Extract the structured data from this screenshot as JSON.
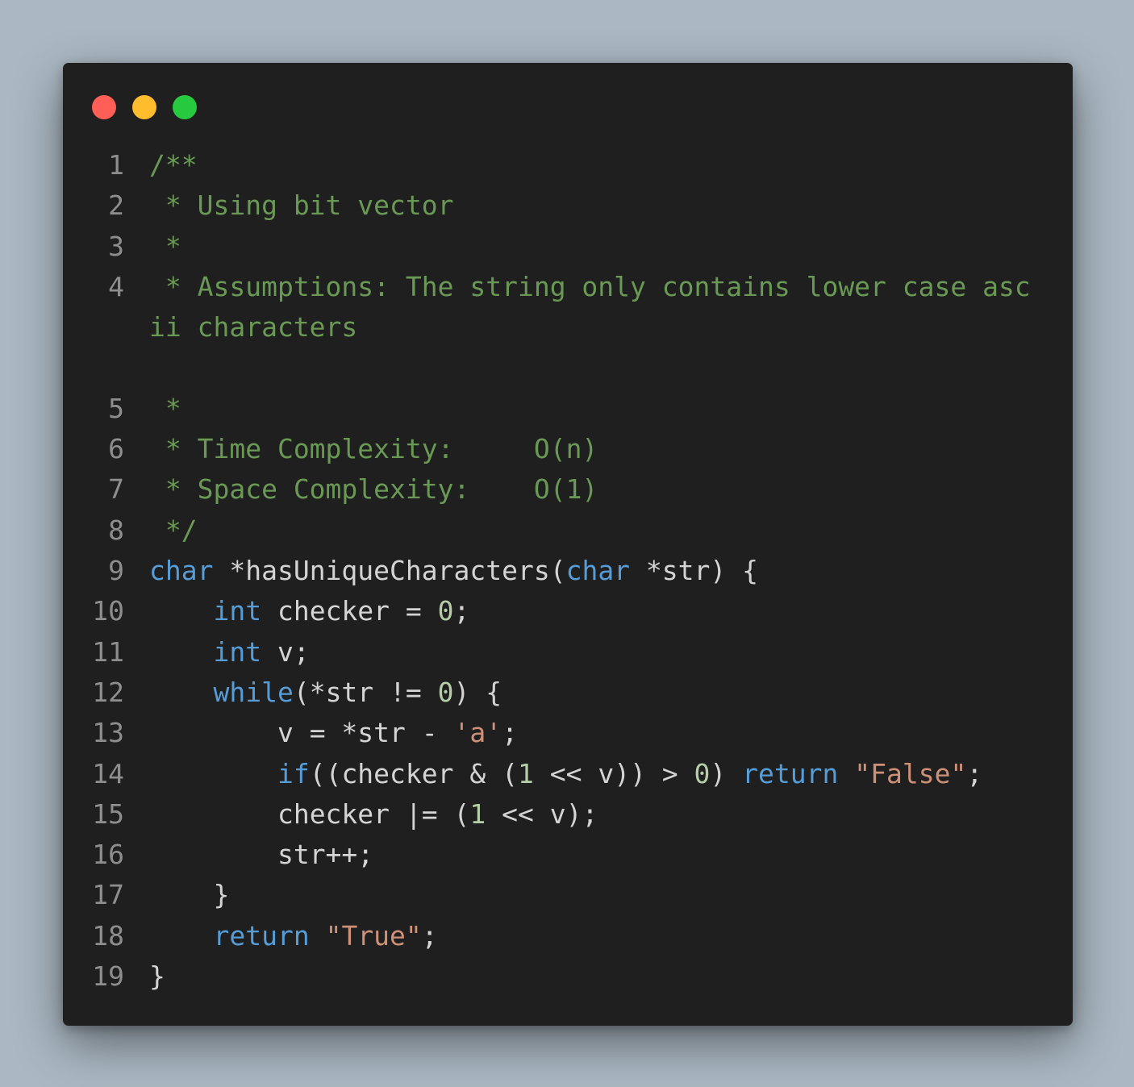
{
  "window": {
    "background": "#1f1f1f",
    "page_background": "#abb8c3",
    "controls": [
      {
        "name": "close",
        "color": "#ff5f56"
      },
      {
        "name": "minimize",
        "color": "#ffbd2e"
      },
      {
        "name": "zoom",
        "color": "#27c93f"
      }
    ]
  },
  "colors": {
    "comment": "#6a9955",
    "keyword": "#569cd6",
    "number": "#b5cea8",
    "string": "#ce9178",
    "plain": "#d4d4d4",
    "line_number": "#8e8e8e"
  },
  "lines": [
    {
      "n": "1",
      "tokens": [
        {
          "t": "comment",
          "v": "/**"
        }
      ]
    },
    {
      "n": "2",
      "tokens": [
        {
          "t": "comment",
          "v": " * Using bit vector"
        }
      ]
    },
    {
      "n": "3",
      "tokens": [
        {
          "t": "comment",
          "v": " *"
        }
      ]
    },
    {
      "n": "4",
      "wrapped": true,
      "tokens": [
        {
          "t": "comment",
          "v": " * Assumptions: The string only contains lower case ascii characters"
        }
      ]
    },
    {
      "n": "5",
      "tokens": [
        {
          "t": "comment",
          "v": " *"
        }
      ]
    },
    {
      "n": "6",
      "tokens": [
        {
          "t": "comment",
          "v": " * Time Complexity:     O(n)"
        }
      ]
    },
    {
      "n": "7",
      "tokens": [
        {
          "t": "comment",
          "v": " * Space Complexity:    O(1)"
        }
      ]
    },
    {
      "n": "8",
      "tokens": [
        {
          "t": "comment",
          "v": " */"
        }
      ]
    },
    {
      "n": "9",
      "tokens": [
        {
          "t": "keyword",
          "v": "char"
        },
        {
          "t": "plain",
          "v": " *hasUniqueCharacters("
        },
        {
          "t": "keyword",
          "v": "char"
        },
        {
          "t": "plain",
          "v": " *str) {"
        }
      ]
    },
    {
      "n": "10",
      "tokens": [
        {
          "t": "plain",
          "v": "    "
        },
        {
          "t": "keyword",
          "v": "int"
        },
        {
          "t": "plain",
          "v": " checker = "
        },
        {
          "t": "number",
          "v": "0"
        },
        {
          "t": "plain",
          "v": ";"
        }
      ]
    },
    {
      "n": "11",
      "tokens": [
        {
          "t": "plain",
          "v": "    "
        },
        {
          "t": "keyword",
          "v": "int"
        },
        {
          "t": "plain",
          "v": " v;"
        }
      ]
    },
    {
      "n": "12",
      "tokens": [
        {
          "t": "plain",
          "v": "    "
        },
        {
          "t": "keyword",
          "v": "while"
        },
        {
          "t": "plain",
          "v": "(*str != "
        },
        {
          "t": "number",
          "v": "0"
        },
        {
          "t": "plain",
          "v": ") {"
        }
      ]
    },
    {
      "n": "13",
      "tokens": [
        {
          "t": "plain",
          "v": "        v = *str - "
        },
        {
          "t": "string",
          "v": "'a'"
        },
        {
          "t": "plain",
          "v": ";"
        }
      ]
    },
    {
      "n": "14",
      "tokens": [
        {
          "t": "plain",
          "v": "        "
        },
        {
          "t": "keyword",
          "v": "if"
        },
        {
          "t": "plain",
          "v": "((checker & ("
        },
        {
          "t": "number",
          "v": "1"
        },
        {
          "t": "plain",
          "v": " << v)) > "
        },
        {
          "t": "number",
          "v": "0"
        },
        {
          "t": "plain",
          "v": ") "
        },
        {
          "t": "keyword",
          "v": "return"
        },
        {
          "t": "plain",
          "v": " "
        },
        {
          "t": "string",
          "v": "\"False\""
        },
        {
          "t": "plain",
          "v": ";"
        }
      ]
    },
    {
      "n": "15",
      "tokens": [
        {
          "t": "plain",
          "v": "        checker |= ("
        },
        {
          "t": "number",
          "v": "1"
        },
        {
          "t": "plain",
          "v": " << v);"
        }
      ]
    },
    {
      "n": "16",
      "tokens": [
        {
          "t": "plain",
          "v": "        str++;"
        }
      ]
    },
    {
      "n": "17",
      "tokens": [
        {
          "t": "plain",
          "v": "    }"
        }
      ]
    },
    {
      "n": "18",
      "tokens": [
        {
          "t": "plain",
          "v": "    "
        },
        {
          "t": "keyword",
          "v": "return"
        },
        {
          "t": "plain",
          "v": " "
        },
        {
          "t": "string",
          "v": "\"True\""
        },
        {
          "t": "plain",
          "v": ";"
        }
      ]
    },
    {
      "n": "19",
      "tokens": [
        {
          "t": "plain",
          "v": "}"
        }
      ]
    }
  ]
}
